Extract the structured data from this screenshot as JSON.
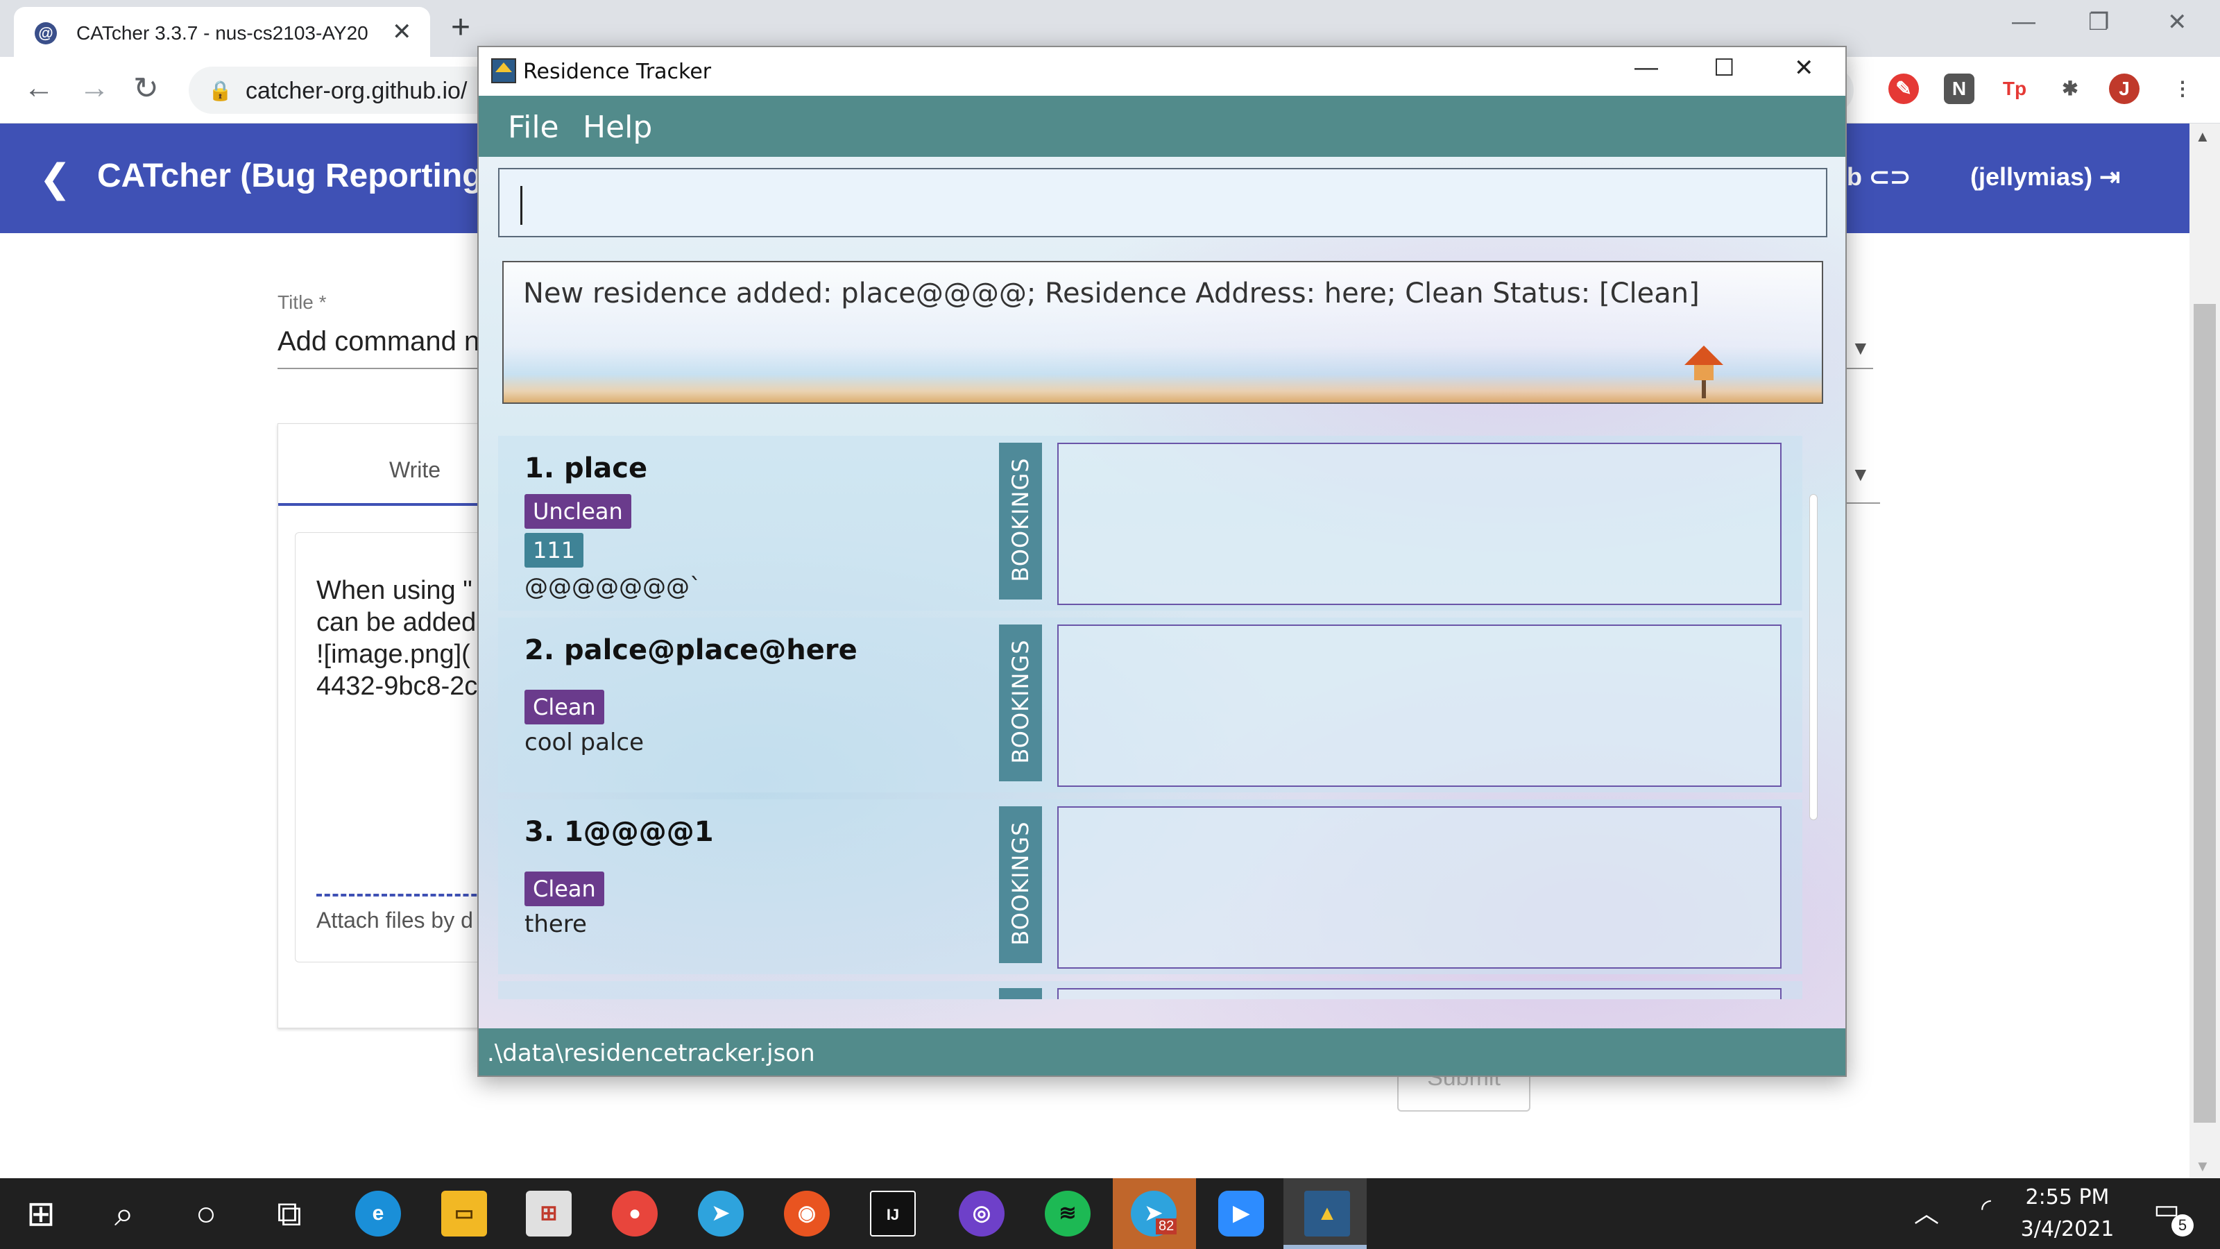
{
  "browser": {
    "tab_title": "CATcher 3.3.7 - nus-cs2103-AY20",
    "url": "catcher-org.github.io/",
    "ext_n": "N",
    "ext_tp": "Tp",
    "profile_initial": "J"
  },
  "catcher": {
    "header_title": "CATcher  (Bug Reporting",
    "github_link": "ub",
    "user": "(jellymias)",
    "title_label": "Title *",
    "title_value": "Add command n",
    "write_tab": "Write",
    "editor_text": "When using \"\ncan be added\n![image.png](\n4432-9bc8-2c",
    "attach_text": "Attach files by d",
    "submit_label": "Submit"
  },
  "app": {
    "window_title": "Residence Tracker",
    "menu": [
      "File",
      "Help"
    ],
    "command_value": "",
    "result_message": "New residence added: place@@@@; Residence Address: here; Clean Status: [Clean]",
    "bookings_label": "BOOKINGS",
    "residences": [
      {
        "index_name": "1.  place",
        "status": "Unclean",
        "extra_tag": "111",
        "address": "@@@@@@@`"
      },
      {
        "index_name": "2.  palce@place@here",
        "status": "Clean",
        "address": "cool palce"
      },
      {
        "index_name": "3.  1@@@@1",
        "status": "Clean",
        "address": "there"
      }
    ],
    "status_bar_path": ".\\data\\residencetracker.json"
  },
  "taskbar": {
    "telegram_badge": "82",
    "time": "2:55 PM",
    "date": "3/4/2021",
    "notification_count": "5"
  }
}
